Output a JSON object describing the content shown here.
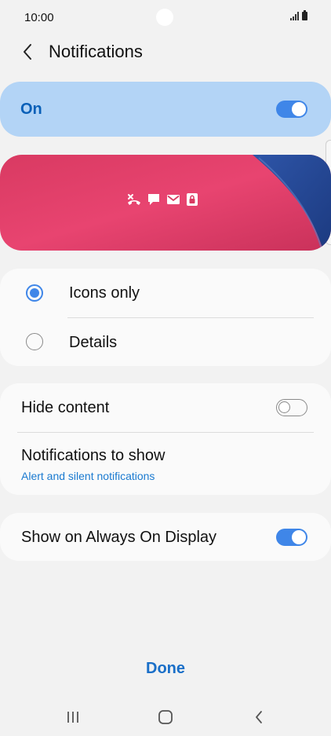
{
  "status_bar": {
    "time": "10:00"
  },
  "header": {
    "title": "Notifications"
  },
  "master_switch": {
    "label": "On",
    "state": "on"
  },
  "style_options": [
    {
      "label": "Icons only",
      "selected": true
    },
    {
      "label": "Details",
      "selected": false
    }
  ],
  "content_settings": {
    "hide_content": {
      "label": "Hide content",
      "state": "off"
    },
    "notifications_to_show": {
      "label": "Notifications to show",
      "value": "Alert and silent notifications"
    }
  },
  "aod": {
    "label": "Show on Always On Display",
    "state": "on"
  },
  "done_label": "Done",
  "colors": {
    "accent": "#3f86e8",
    "master_bg": "#b3d4f6",
    "link": "#1a7ad0"
  }
}
